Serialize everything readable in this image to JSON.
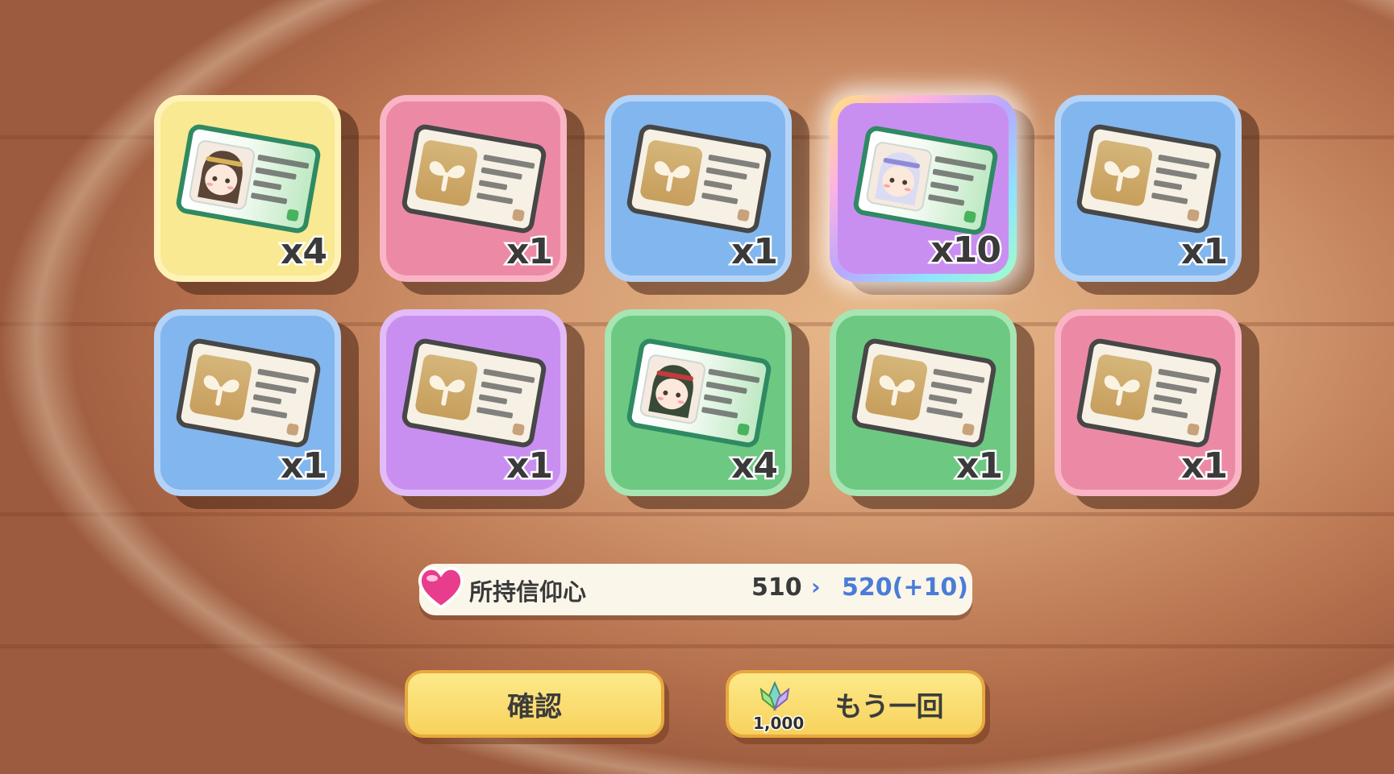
{
  "results": [
    {
      "color": "yellow",
      "kind": "portrait",
      "portrait": "character-brown-hair-icon",
      "qty": "x4"
    },
    {
      "color": "pink",
      "kind": "sprout",
      "qty": "x1"
    },
    {
      "color": "blue",
      "kind": "sprout",
      "qty": "x1"
    },
    {
      "color": "rainbow",
      "kind": "portrait",
      "portrait": "character-silver-hair-icon",
      "qty": "x10"
    },
    {
      "color": "blue",
      "kind": "sprout",
      "qty": "x1"
    },
    {
      "color": "blue",
      "kind": "sprout",
      "qty": "x1"
    },
    {
      "color": "purple",
      "kind": "sprout",
      "qty": "x1"
    },
    {
      "color": "green",
      "kind": "portrait",
      "portrait": "character-green-hair-icon",
      "qty": "x4"
    },
    {
      "color": "green",
      "kind": "sprout",
      "qty": "x1"
    },
    {
      "color": "pink",
      "kind": "sprout",
      "qty": "x1"
    }
  ],
  "faith": {
    "icon": "heart-icon",
    "label": "所持信仰心",
    "current": "510",
    "arrow": "›",
    "new": "520(+10)"
  },
  "buttons": {
    "confirm": "確認",
    "again": "もう一回",
    "again_cost": "1,000",
    "again_cost_icon": "leaf-gem-icon"
  },
  "colors": {
    "accent_blue": "#4a7cd8",
    "button_yellow": "#f7d25c"
  }
}
